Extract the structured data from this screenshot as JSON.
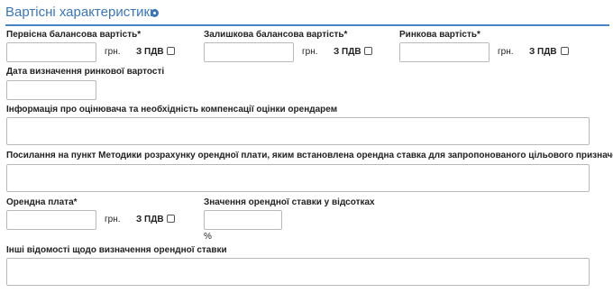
{
  "section": {
    "title": "Вартісні характеристики"
  },
  "initial_value": {
    "label": "Первісна балансова вартість*",
    "value": "",
    "unit": "грн.",
    "vat_label": "З ПДВ",
    "vat_checked": false
  },
  "residual_value": {
    "label": "Залишкова балансова вартість*",
    "value": "",
    "unit": "грн.",
    "vat_label": "З ПДВ",
    "vat_checked": false
  },
  "market_value": {
    "label": "Ринкова вартість*",
    "value": "",
    "unit": "грн.",
    "vat_label": "З ПДВ",
    "vat_checked": false
  },
  "market_value_date": {
    "label": "Дата визначення ринкової вартості",
    "value": ""
  },
  "appraiser_info": {
    "label": "Інформація про оцінювача та необхідність компенсації оцінки орендарем",
    "value": ""
  },
  "methodology_reference": {
    "label": "Посилання на пункт Методики розрахунку орендної плати, яким встановлена орендна ставка для запропонованого цільового призначення",
    "value": ""
  },
  "rent": {
    "label": "Орендна плата*",
    "value": "",
    "unit": "грн.",
    "vat_label": "З ПДВ",
    "vat_checked": false
  },
  "rent_rate": {
    "label": "Значення орендної ставки у відсотках",
    "value": "",
    "unit": "%"
  },
  "other_info": {
    "label": "Інші відомості щодо визначення орендної ставки",
    "value": ""
  }
}
